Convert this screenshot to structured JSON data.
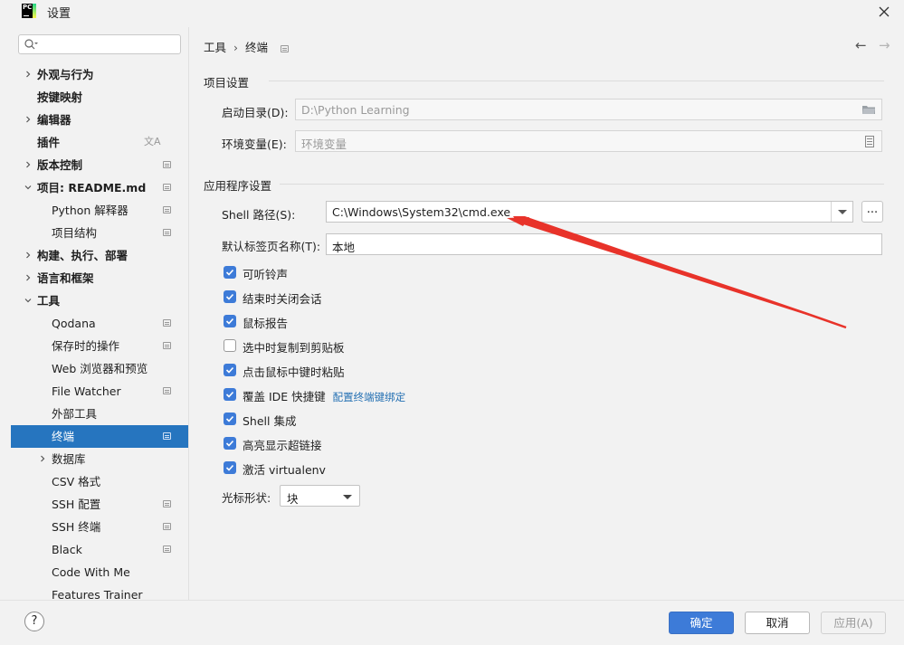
{
  "window": {
    "title": "设置",
    "logo_text": "PC"
  },
  "sidebar": {
    "search_placeholder": "",
    "items": [
      {
        "label": "外观与行为",
        "bold": true,
        "chevron": "right",
        "indent": 0,
        "icon": ""
      },
      {
        "label": "按键映射",
        "bold": true,
        "chevron": "",
        "indent": 0,
        "icon": ""
      },
      {
        "label": "编辑器",
        "bold": true,
        "chevron": "right",
        "indent": 0,
        "icon": ""
      },
      {
        "label": "插件",
        "bold": true,
        "chevron": "",
        "indent": 0,
        "icon": "translate-icon"
      },
      {
        "label": "版本控制",
        "bold": true,
        "chevron": "right",
        "indent": 0,
        "icon": "project-scope-icon"
      },
      {
        "label": "项目: README.md",
        "bold": true,
        "chevron": "down",
        "indent": 0,
        "icon": "project-scope-icon"
      },
      {
        "label": "Python 解释器",
        "bold": false,
        "chevron": "",
        "indent": 1,
        "icon": "project-scope-icon"
      },
      {
        "label": "项目结构",
        "bold": false,
        "chevron": "",
        "indent": 1,
        "icon": "project-scope-icon"
      },
      {
        "label": "构建、执行、部署",
        "bold": true,
        "chevron": "right",
        "indent": 0,
        "icon": ""
      },
      {
        "label": "语言和框架",
        "bold": true,
        "chevron": "right",
        "indent": 0,
        "icon": ""
      },
      {
        "label": "工具",
        "bold": true,
        "chevron": "down",
        "indent": 0,
        "icon": ""
      },
      {
        "label": "Qodana",
        "bold": false,
        "chevron": "",
        "indent": 1,
        "icon": "project-scope-icon"
      },
      {
        "label": "保存时的操作",
        "bold": false,
        "chevron": "",
        "indent": 1,
        "icon": "project-scope-icon"
      },
      {
        "label": "Web 浏览器和预览",
        "bold": false,
        "chevron": "",
        "indent": 1,
        "icon": ""
      },
      {
        "label": "File Watcher",
        "bold": false,
        "chevron": "",
        "indent": 1,
        "icon": "project-scope-icon"
      },
      {
        "label": "外部工具",
        "bold": false,
        "chevron": "",
        "indent": 1,
        "icon": ""
      },
      {
        "label": "终端",
        "bold": false,
        "chevron": "",
        "indent": 1,
        "icon": "project-scope-icon",
        "selected": true
      },
      {
        "label": "数据库",
        "bold": false,
        "chevron": "right",
        "indent": 1,
        "icon": ""
      },
      {
        "label": "CSV 格式",
        "bold": false,
        "chevron": "",
        "indent": 1,
        "icon": ""
      },
      {
        "label": "SSH 配置",
        "bold": false,
        "chevron": "",
        "indent": 1,
        "icon": "project-scope-icon"
      },
      {
        "label": "SSH 终端",
        "bold": false,
        "chevron": "",
        "indent": 1,
        "icon": "project-scope-icon"
      },
      {
        "label": "Black",
        "bold": false,
        "chevron": "",
        "indent": 1,
        "icon": "project-scope-icon"
      },
      {
        "label": "Code With Me",
        "bold": false,
        "chevron": "",
        "indent": 1,
        "icon": ""
      },
      {
        "label": "Features Trainer",
        "bold": false,
        "chevron": "",
        "indent": 1,
        "icon": ""
      }
    ]
  },
  "breadcrumb": {
    "parent": "工具",
    "separator": "›",
    "current": "终端"
  },
  "nav": {
    "back": "←",
    "forward": "→"
  },
  "project_settings": {
    "title": "项目设置",
    "start_dir_label": "启动目录(D):",
    "start_dir_value": "D:\\Python Learning",
    "env_vars_label": "环境变量(E):",
    "env_vars_placeholder": "环境变量"
  },
  "app_settings": {
    "title": "应用程序设置",
    "shell_path_label": "Shell 路径(S):",
    "shell_path_value": "C:\\Windows\\System32\\cmd.exe",
    "browse_label": "...",
    "tab_name_label": "默认标签页名称(T):",
    "tab_name_value": "本地",
    "checkboxes": [
      {
        "label": "可听铃声",
        "checked": true
      },
      {
        "label": "结束时关闭会话",
        "checked": true
      },
      {
        "label": "鼠标报告",
        "checked": true
      },
      {
        "label": "选中时复制到剪贴板",
        "checked": false
      },
      {
        "label": "点击鼠标中键时粘贴",
        "checked": true
      },
      {
        "label": "覆盖 IDE 快捷键",
        "checked": true,
        "link": "配置终端键绑定"
      },
      {
        "label": "Shell 集成",
        "checked": true
      },
      {
        "label": "高亮显示超链接",
        "checked": true
      },
      {
        "label": "激活 virtualenv",
        "checked": true
      }
    ],
    "cursor_shape_label": "光标形状:",
    "cursor_shape_value": "块"
  },
  "footer": {
    "help": "?",
    "ok": "确定",
    "cancel": "取消",
    "apply": "应用(A)"
  },
  "colors": {
    "accent": "#3d7bd8",
    "selection": "#2675bf",
    "annotation_arrow": "#e8332a",
    "link": "#2470b3"
  }
}
